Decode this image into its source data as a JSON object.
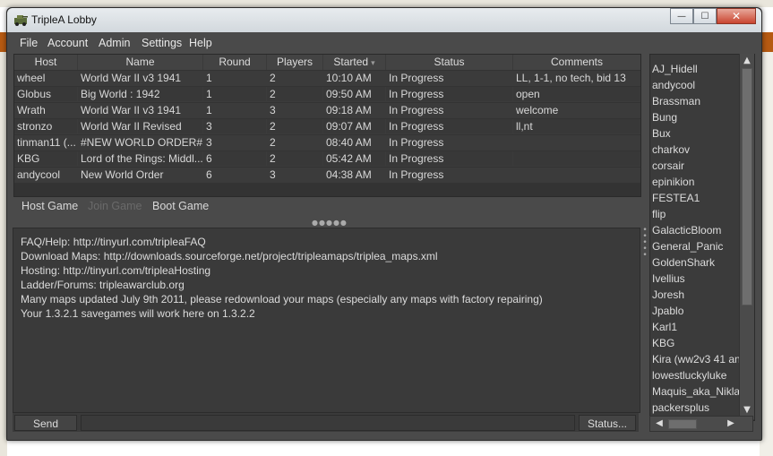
{
  "window": {
    "title": "TripleA Lobby"
  },
  "window_controls": {
    "minimize": "—",
    "maximize": "☐",
    "close": "✕"
  },
  "menu": [
    "File",
    "Account",
    "Admin",
    "Settings",
    "Help"
  ],
  "games_table": {
    "columns": [
      "Host",
      "Name",
      "Round",
      "Players",
      "Started",
      "Status",
      "Comments"
    ],
    "sort_icon": "▾",
    "rows": [
      [
        "wheel",
        "World War II v3 1941",
        "1",
        "2",
        "10:10 AM",
        "In Progress",
        "LL, 1-1, no tech, bid 13"
      ],
      [
        "Globus",
        "Big World : 1942",
        "1",
        "2",
        "09:50 AM",
        "In Progress",
        "open"
      ],
      [
        "Wrath",
        "World War II v3 1941",
        "1",
        "3",
        "09:18 AM",
        "In Progress",
        "welcome"
      ],
      [
        "stronzo",
        "World War II Revised",
        "3",
        "2",
        "09:07 AM",
        "In Progress",
        "ll,nt"
      ],
      [
        "tinman11 (...",
        "#NEW WORLD ORDER#",
        "3",
        "2",
        "08:40 AM",
        "In Progress",
        ""
      ],
      [
        "KBG",
        "Lord of the Rings: Middl...",
        "6",
        "2",
        "05:42 AM",
        "In Progress",
        ""
      ],
      [
        "andycool",
        "New World Order",
        "6",
        "3",
        "04:38 AM",
        "In Progress",
        ""
      ]
    ]
  },
  "game_buttons": {
    "host": "Host Game",
    "join": "Join Game",
    "boot": "Boot Game"
  },
  "chat_lines": [
    "FAQ/Help: http://tinyurl.com/tripleaFAQ",
    "Download Maps: http://downloads.sourceforge.net/project/tripleamaps/triplea_maps.xml",
    "Hosting: http://tinyurl.com/tripleaHosting",
    "Ladder/Forums: tripleawarclub.org",
    "Many maps updated July 9th 2011, please redownload your maps (especially any maps with factory repairing)",
    "Your 1.3.2.1 savegames will work here on 1.3.2.2"
  ],
  "bottom": {
    "send": "Send",
    "status": "Status..."
  },
  "players": [
    "AJ_Hidell",
    "andycool",
    "Brassman",
    "Bung",
    "Bux",
    "charkov",
    "corsair",
    "epinikion",
    "FESTEA1",
    "flip",
    "GalacticBloom",
    "General_Panic",
    "GoldenShark",
    "Ivellius",
    "Joresh",
    "Jpablo",
    "Karl1",
    "KBG",
    "Kira (ww2v3 41 any",
    "lowestluckyluke",
    "Maquis_aka_Niklas",
    "packersplus"
  ],
  "scroll": {
    "up": "▲",
    "down": "▼",
    "left": "◀",
    "right": "▶"
  },
  "colors": {
    "window_bg": "#4a4a4a",
    "panel_bg": "#3a3a3a",
    "text": "#dcdcdc",
    "disabled_text": "#6a6a6a"
  }
}
